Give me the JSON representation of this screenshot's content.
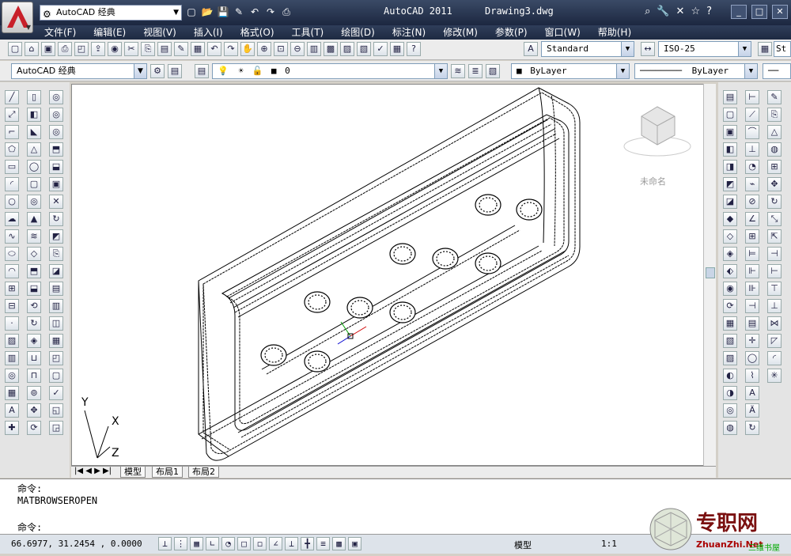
{
  "window": {
    "app_title": "AutoCAD 2011",
    "doc_name": "Drawing3.dwg",
    "workspace": "AutoCAD 经典"
  },
  "menu": [
    "文件(F)",
    "编辑(E)",
    "视图(V)",
    "插入(I)",
    "格式(O)",
    "工具(T)",
    "绘图(D)",
    "标注(N)",
    "修改(M)",
    "参数(P)",
    "窗口(W)",
    "帮助(H)"
  ],
  "toolbar": {
    "text_style": "Standard",
    "dim_style": "ISO-25",
    "table_style": "St",
    "workspace2": "AutoCAD 经典",
    "layer": "0",
    "color": "ByLayer",
    "linetype": "ByLayer"
  },
  "viewcube": {
    "label": "未命名"
  },
  "ucs": {
    "x": "X",
    "y": "Y",
    "z": "Z"
  },
  "tabs": [
    "模型",
    "布局1",
    "布局2"
  ],
  "command": {
    "line1": "命令:",
    "line2": "MATBROWSEROPEN",
    "prompt": "命令:"
  },
  "status": {
    "coords": "66.6977,  31.2454 , 0.0000",
    "model_label": "模型",
    "scale": "1:1"
  },
  "watermark": {
    "site": "专职网",
    "url": "ZhuanZhi.Net",
    "tag": "三维书屋"
  },
  "colors": {
    "title_bg": "#1c2740",
    "accent_red": "#c8202a",
    "viewport_bg": "#ffffff"
  }
}
